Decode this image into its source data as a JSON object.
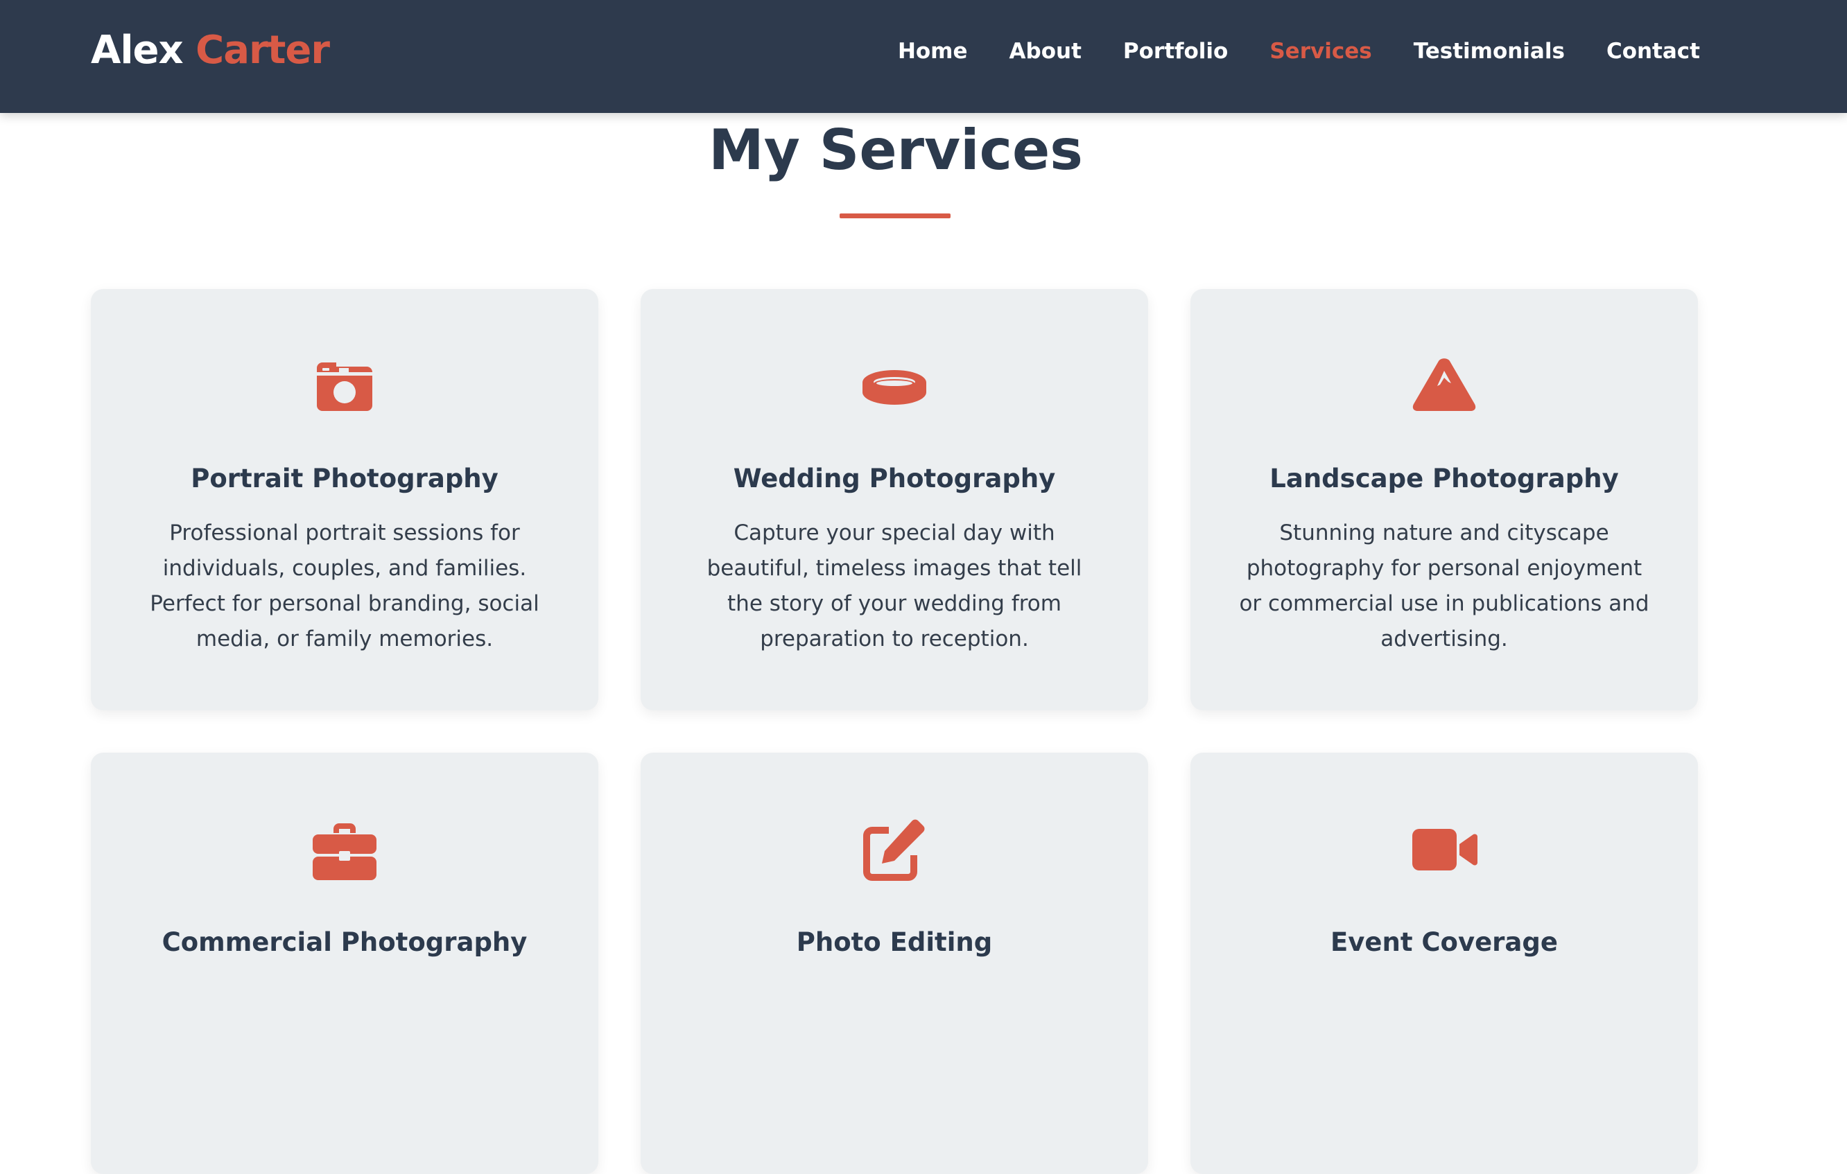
{
  "brand": {
    "first": "Alex",
    "last": "Carter"
  },
  "colors": {
    "header_bg": "#2e3a4d",
    "accent": "#d85a46",
    "card_bg": "#eceff1",
    "text": "#2c3a4d"
  },
  "nav": {
    "items": [
      {
        "label": "Home",
        "active": false
      },
      {
        "label": "About",
        "active": false
      },
      {
        "label": "Portfolio",
        "active": false
      },
      {
        "label": "Services",
        "active": true
      },
      {
        "label": "Testimonials",
        "active": false
      },
      {
        "label": "Contact",
        "active": false
      }
    ]
  },
  "section": {
    "title": "My Services"
  },
  "services": [
    {
      "icon": "camera-icon",
      "title": "Portrait Photography",
      "description": "Professional portrait sessions for individuals, couples, and families. Perfect for personal branding, social media, or family memories."
    },
    {
      "icon": "ring-icon",
      "title": "Wedding Photography",
      "description": "Capture your special day with beautiful, timeless images that tell the story of your wedding from preparation to reception."
    },
    {
      "icon": "mountain-icon",
      "title": "Landscape Photography",
      "description": "Stunning nature and cityscape photography for personal enjoyment or commercial use in publications and advertising."
    },
    {
      "icon": "briefcase-icon",
      "title": "Commercial Photography",
      "description": ""
    },
    {
      "icon": "edit-icon",
      "title": "Photo Editing",
      "description": ""
    },
    {
      "icon": "video-icon",
      "title": "Event Coverage",
      "description": ""
    }
  ]
}
